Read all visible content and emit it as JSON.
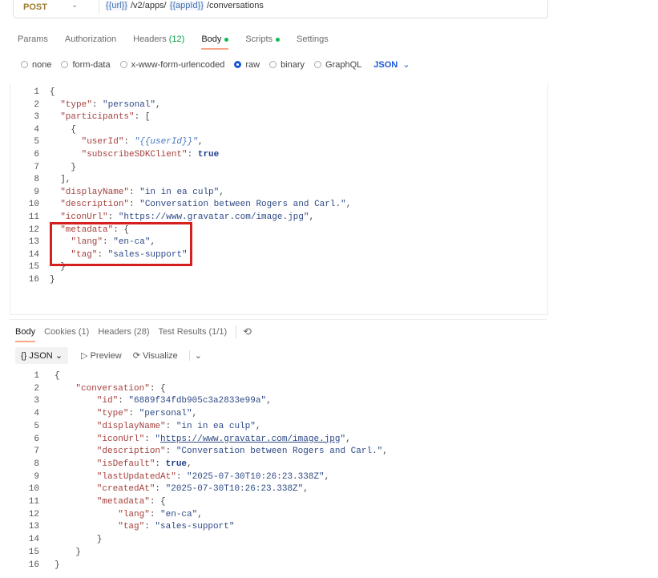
{
  "request": {
    "method": "POST",
    "url": {
      "p1": "{{url}}",
      "p2": " /v2/apps/ ",
      "p3": "{{appId}}",
      "p4": " /conversations"
    },
    "tabs": [
      {
        "label": "Params"
      },
      {
        "label": "Authorization"
      },
      {
        "label": "Headers",
        "count": "(12)"
      },
      {
        "label": "Body"
      },
      {
        "label": "Scripts"
      },
      {
        "label": "Settings"
      }
    ],
    "body_types": [
      "none",
      "form-data",
      "x-www-form-urlencoded",
      "raw",
      "binary",
      "GraphQL"
    ],
    "selected_body_type": "raw",
    "language": "JSON",
    "lines": [
      [
        [
          "p",
          "{"
        ]
      ],
      [
        [
          "k",
          "  \"type\""
        ],
        [
          "p",
          ": "
        ],
        [
          "s",
          "\"personal\""
        ],
        [
          "p",
          ","
        ]
      ],
      [
        [
          "k",
          "  \"participants\""
        ],
        [
          "p",
          ": ["
        ]
      ],
      [
        [
          "p",
          "    {"
        ]
      ],
      [
        [
          "k",
          "      \"userId\""
        ],
        [
          "p",
          ": "
        ],
        [
          "it",
          "\"{{userId}}\""
        ],
        [
          "p",
          ","
        ]
      ],
      [
        [
          "k",
          "      \"subscribeSDKClient\""
        ],
        [
          "p",
          ": "
        ],
        [
          "b",
          "true"
        ]
      ],
      [
        [
          "p",
          "    }"
        ]
      ],
      [
        [
          "p",
          "  ],"
        ]
      ],
      [
        [
          "k",
          "  \"displayName\""
        ],
        [
          "p",
          ": "
        ],
        [
          "s",
          "\"in in ea culp\""
        ],
        [
          "p",
          ","
        ]
      ],
      [
        [
          "k",
          "  \"description\""
        ],
        [
          "p",
          ": "
        ],
        [
          "s",
          "\"Conversation between Rogers and Carl.\""
        ],
        [
          "p",
          ","
        ]
      ],
      [
        [
          "k",
          "  \"iconUrl\""
        ],
        [
          "p",
          ": "
        ],
        [
          "s",
          "\"https://www.gravatar.com/image.jpg\""
        ],
        [
          "p",
          ","
        ]
      ],
      [
        [
          "k",
          "  \"metadata\""
        ],
        [
          "p",
          ": {"
        ]
      ],
      [
        [
          "k",
          "    \"lang\""
        ],
        [
          "p",
          ": "
        ],
        [
          "s",
          "\"en-ca\""
        ],
        [
          "p",
          ","
        ]
      ],
      [
        [
          "k",
          "    \"tag\""
        ],
        [
          "p",
          ": "
        ],
        [
          "s",
          "\"sales-support\""
        ]
      ],
      [
        [
          "p",
          "  }"
        ]
      ],
      [
        [
          "p",
          "}"
        ]
      ]
    ]
  },
  "response": {
    "tabs": [
      {
        "label": "Body"
      },
      {
        "label": "Cookies (1)"
      },
      {
        "label": "Headers (28)"
      },
      {
        "label": "Test Results (1/1)"
      }
    ],
    "format": "{} JSON",
    "preview": "Preview",
    "visualize": "Visualize",
    "lines": [
      [
        [
          "p",
          "{"
        ]
      ],
      [
        [
          "k",
          "    \"conversation\""
        ],
        [
          "p",
          ": {"
        ]
      ],
      [
        [
          "k",
          "        \"id\""
        ],
        [
          "p",
          ": "
        ],
        [
          "s",
          "\"6889f34fdb905c3a2833e99a\""
        ],
        [
          "p",
          ","
        ]
      ],
      [
        [
          "k",
          "        \"type\""
        ],
        [
          "p",
          ": "
        ],
        [
          "s",
          "\"personal\""
        ],
        [
          "p",
          ","
        ]
      ],
      [
        [
          "k",
          "        \"displayName\""
        ],
        [
          "p",
          ": "
        ],
        [
          "s",
          "\"in in ea culp\""
        ],
        [
          "p",
          ","
        ]
      ],
      [
        [
          "k",
          "        \"iconUrl\""
        ],
        [
          "p",
          ": "
        ],
        [
          "s",
          "\""
        ],
        [
          "u",
          "https://www.gravatar.com/image.jpg"
        ],
        [
          "s",
          "\""
        ],
        [
          "p",
          ","
        ]
      ],
      [
        [
          "k",
          "        \"description\""
        ],
        [
          "p",
          ": "
        ],
        [
          "s",
          "\"Conversation between Rogers and Carl.\""
        ],
        [
          "p",
          ","
        ]
      ],
      [
        [
          "k",
          "        \"isDefault\""
        ],
        [
          "p",
          ": "
        ],
        [
          "b",
          "true"
        ],
        [
          "p",
          ","
        ]
      ],
      [
        [
          "k",
          "        \"lastUpdatedAt\""
        ],
        [
          "p",
          ": "
        ],
        [
          "s",
          "\"2025-07-30T10:26:23.338Z\""
        ],
        [
          "p",
          ","
        ]
      ],
      [
        [
          "k",
          "        \"createdAt\""
        ],
        [
          "p",
          ": "
        ],
        [
          "s",
          "\"2025-07-30T10:26:23.338Z\""
        ],
        [
          "p",
          ","
        ]
      ],
      [
        [
          "k",
          "        \"metadata\""
        ],
        [
          "p",
          ": {"
        ]
      ],
      [
        [
          "k",
          "            \"lang\""
        ],
        [
          "p",
          ": "
        ],
        [
          "s",
          "\"en-ca\""
        ],
        [
          "p",
          ","
        ]
      ],
      [
        [
          "k",
          "            \"tag\""
        ],
        [
          "p",
          ": "
        ],
        [
          "s",
          "\"sales-support\""
        ]
      ],
      [
        [
          "p",
          "        }"
        ]
      ],
      [
        [
          "p",
          "    }"
        ]
      ],
      [
        [
          "p",
          "}"
        ]
      ]
    ]
  }
}
